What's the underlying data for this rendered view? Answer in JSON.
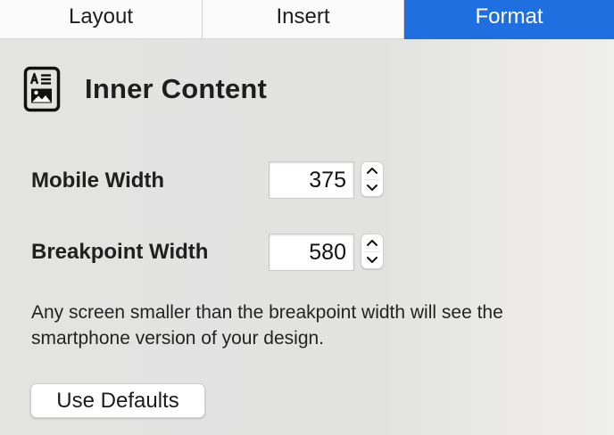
{
  "tabs": [
    {
      "label": "Layout",
      "active": false
    },
    {
      "label": "Insert",
      "active": false
    },
    {
      "label": "Format",
      "active": true
    }
  ],
  "section": {
    "title": "Inner Content",
    "icon": "content-block-icon"
  },
  "fields": {
    "mobile_width": {
      "label": "Mobile Width",
      "value": "375"
    },
    "breakpoint_width": {
      "label": "Breakpoint Width",
      "value": "580"
    }
  },
  "help_text": "Any screen smaller than the breakpoint width will see the smartphone version of your design.",
  "defaults_button": "Use Defaults",
  "colors": {
    "accent": "#1f6fe0",
    "panel_background": "#e3e3e2"
  }
}
